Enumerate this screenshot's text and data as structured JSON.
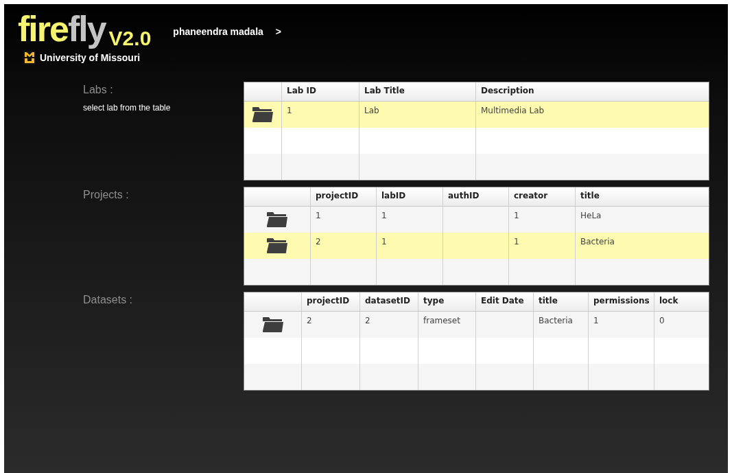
{
  "header": {
    "logo_primary": "fire",
    "logo_secondary": "fly",
    "version": "V2.0",
    "university": "University of Missouri",
    "user_name": "phaneendra madala",
    "user_arrow": ">"
  },
  "sections": [
    {
      "label": "Labs :",
      "hint": "select lab from the table",
      "columns": [
        "Lab ID",
        "Lab Title",
        "Description"
      ],
      "rows": [
        {
          "selected": true,
          "cells": [
            "1",
            "Lab",
            "Multimedia Lab"
          ]
        }
      ]
    },
    {
      "label": "Projects :",
      "columns": [
        "projectID",
        "labID",
        "authID",
        "creator",
        "title"
      ],
      "rows": [
        {
          "selected": false,
          "cells": [
            "1",
            "1",
            "",
            "1",
            "HeLa"
          ]
        },
        {
          "selected": true,
          "cells": [
            "2",
            "1",
            "",
            "1",
            "Bacteria"
          ]
        }
      ]
    },
    {
      "label": "Datasets :",
      "columns": [
        "projectID",
        "datasetID",
        "type",
        "Edit Date",
        "title",
        "permissions",
        "lock"
      ],
      "rows": [
        {
          "selected": false,
          "cells": [
            "2",
            "2",
            "frameset",
            "",
            "Bacteria",
            "1",
            "0"
          ]
        }
      ]
    }
  ]
}
